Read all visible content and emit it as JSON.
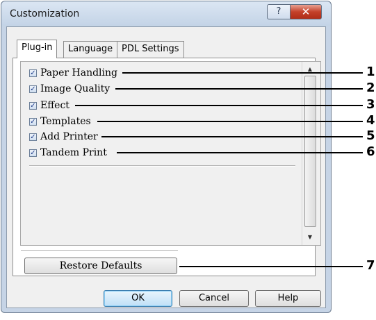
{
  "window": {
    "title": "Customization",
    "help_glyph": "?",
    "close_glyph": "✕"
  },
  "tabs": [
    {
      "label": "Plug-in",
      "active": true
    },
    {
      "label": "Language",
      "active": false
    },
    {
      "label": "PDL Settings",
      "active": false
    }
  ],
  "plugins": [
    {
      "label": "Paper Handling",
      "checked": true
    },
    {
      "label": "Image Quality",
      "checked": true
    },
    {
      "label": "Effect",
      "checked": true
    },
    {
      "label": "Templates",
      "checked": true
    },
    {
      "label": "Add Printer",
      "checked": true
    },
    {
      "label": "Tandem Print",
      "checked": true
    }
  ],
  "checkmark": "✓",
  "scroll": {
    "up": "▲",
    "down": "▼"
  },
  "buttons": {
    "restore_defaults": "Restore Defaults",
    "ok": "OK",
    "cancel": "Cancel",
    "help": "Help"
  },
  "callouts": [
    "1",
    "2",
    "3",
    "4",
    "5",
    "6",
    "7"
  ],
  "colors": {
    "frame": "#c6d4e6",
    "close_button": "#c4412a",
    "default_button": "#bfe0f7"
  }
}
